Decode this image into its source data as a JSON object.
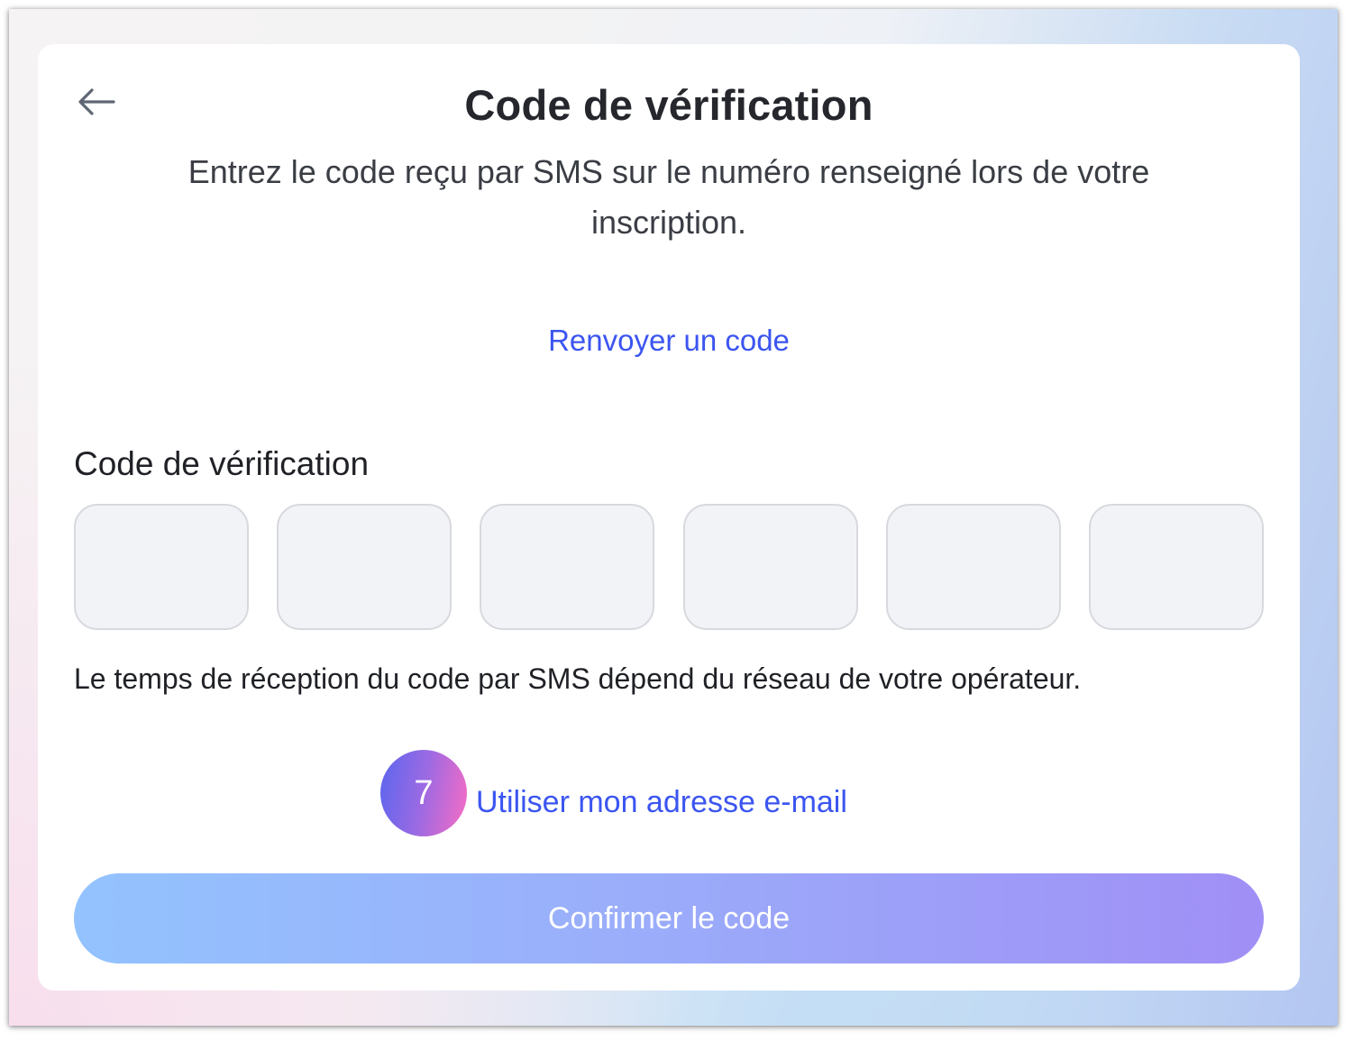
{
  "header": {
    "title": "Code de vérification",
    "subtitle": "Entrez le code reçu par SMS sur le numéro renseigné lors de votre inscription."
  },
  "resend_link": "Renvoyer un code",
  "code_field": {
    "label": "Code de vérification",
    "digits": [
      "",
      "",
      "",
      "",
      "",
      ""
    ]
  },
  "hint": "Le temps de réception du code par SMS dépend du réseau de votre opérateur.",
  "email_option": {
    "badge": "7",
    "label": "Utiliser mon adresse e-mail"
  },
  "confirm_button": "Confirmer le code",
  "colors": {
    "link": "#3b55f0",
    "text": "#25272d",
    "button_gradient_start": "#93c3fe",
    "button_gradient_end": "#a08ff6"
  }
}
